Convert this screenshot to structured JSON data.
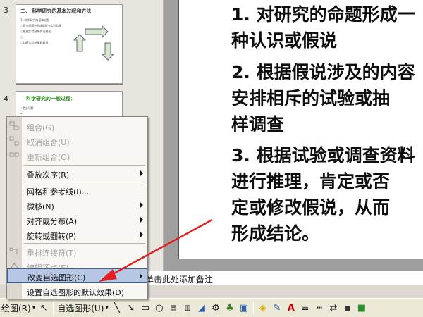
{
  "thumbnails": [
    {
      "number": "3",
      "title": "二、 科学研究的基本过程和方法",
      "lines": [
        "1) 科学研究的基本过程",
        "○提出问题→形成假说→实验验证",
        "○根据实验结果得出结论",
        "○",
        "○判断实验结果和假说"
      ]
    },
    {
      "number": "4",
      "title": "科学研究的一般过程：",
      "lines": [
        "•提出问题",
        "•",
        "•"
      ]
    }
  ],
  "slide": {
    "lines": [
      "1. 对研究的命题形成一",
      "   种认识或假说",
      "2. 根据假说涉及的内容",
      "   安排相斥的试验或抽",
      "   样调查",
      "3. 根据试验或调查资料",
      "   进行推理，肯定或否",
      "   定或修改假说，从而",
      "   形成结论。"
    ]
  },
  "notes": {
    "placeholder": "单击此处添加备注"
  },
  "context_menu": {
    "items": [
      {
        "label": "组合(G)",
        "enabled": false,
        "submenu": false,
        "icon": "group-icon"
      },
      {
        "label": "取消组合(U)",
        "enabled": false,
        "submenu": false,
        "icon": "ungroup-icon"
      },
      {
        "label": "重新组合(O)",
        "enabled": false,
        "submenu": false,
        "icon": "regroup-icon"
      },
      {
        "label": "叠放次序(R)",
        "enabled": true,
        "submenu": true
      },
      {
        "label": "网格和参考线(I)...",
        "enabled": true,
        "submenu": false
      },
      {
        "label": "微移(N)",
        "enabled": true,
        "submenu": true
      },
      {
        "label": "对齐或分布(A)",
        "enabled": true,
        "submenu": true
      },
      {
        "label": "旋转或翻转(P)",
        "enabled": true,
        "submenu": true
      },
      {
        "label": "重排连接符(T)",
        "enabled": false,
        "submenu": false,
        "icon": "reroute-icon"
      },
      {
        "label": "编辑顶点(E)",
        "enabled": false,
        "submenu": false,
        "icon": "edit-points-icon"
      },
      {
        "label": "改变自选图形(C)",
        "enabled": true,
        "submenu": true,
        "highlighted": true
      },
      {
        "label": "设置自选图形的默认效果(D)",
        "enabled": true,
        "submenu": false
      }
    ]
  },
  "toolbar": {
    "draw_label": "绘图(R)",
    "autoshapes_label": "自选图形(U)"
  },
  "colors": {
    "highlight": "#b6c7e6",
    "arrow": "#e02020",
    "thumb_green_title": "#2a8a18"
  }
}
